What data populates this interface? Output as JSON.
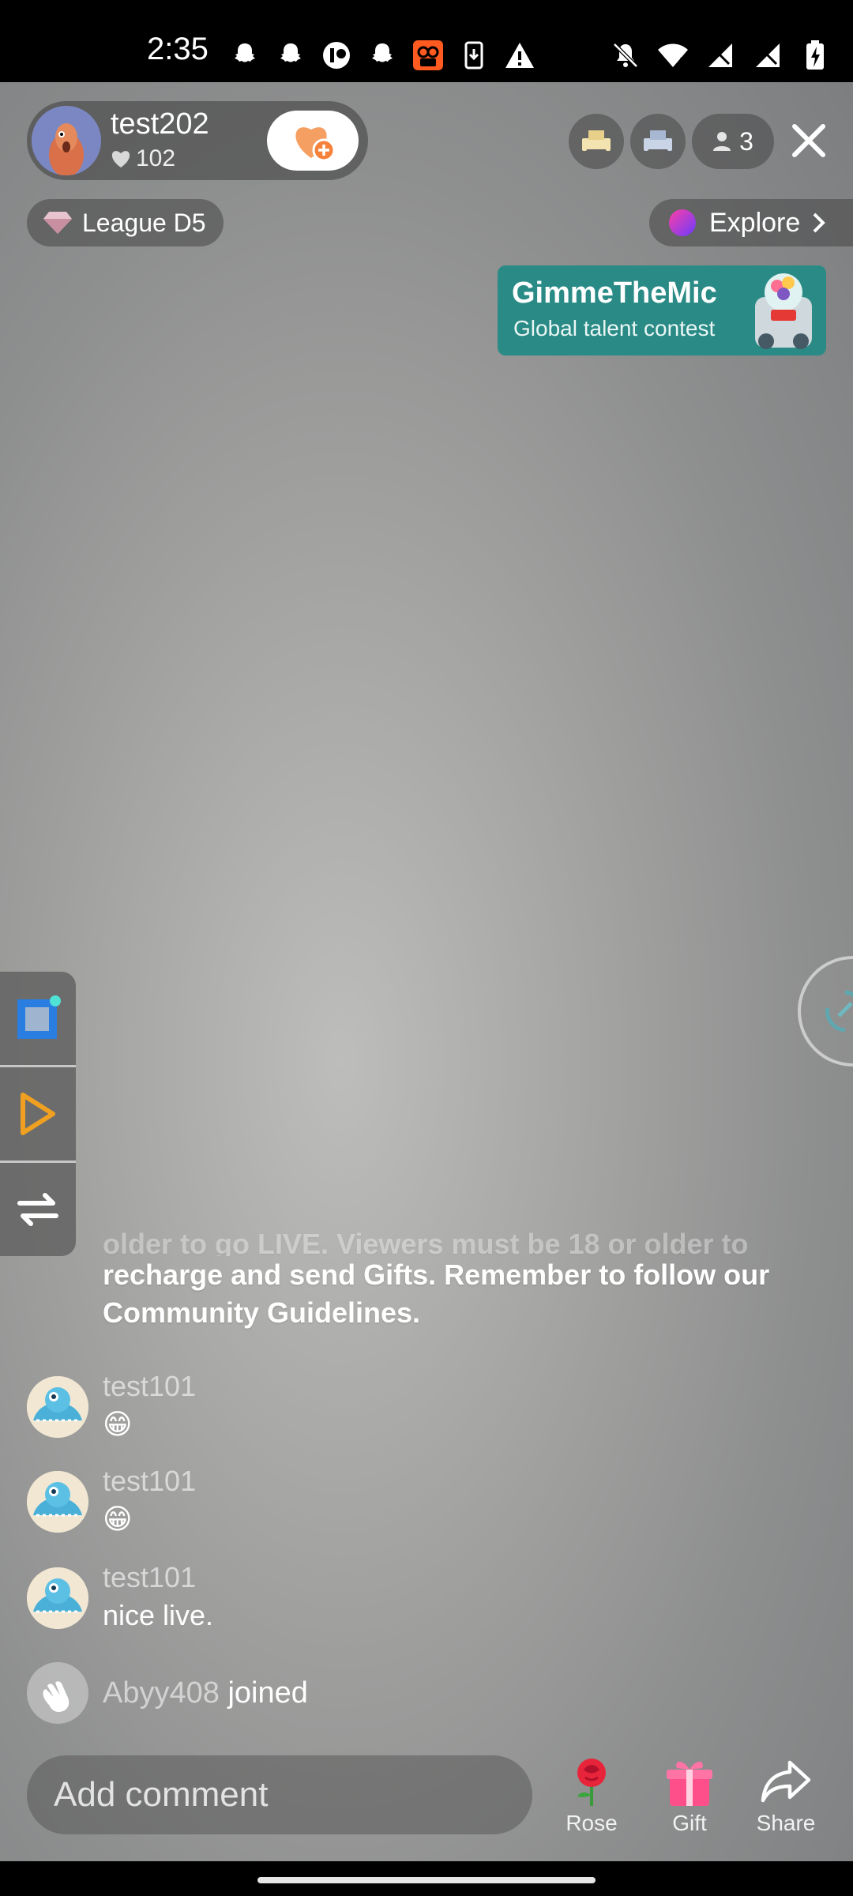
{
  "status_bar": {
    "time": "2:35",
    "left_icons": [
      "snapchat-icon",
      "snapchat-icon",
      "app-icon",
      "snapchat-icon",
      "camera-app-icon",
      "download-icon",
      "warning-icon"
    ],
    "right_icons": [
      "mute-icon",
      "wifi-icon",
      "signal-icon",
      "signal-icon",
      "battery-charging-icon"
    ]
  },
  "host": {
    "name": "test202",
    "likes": "102"
  },
  "viewer_count": "3",
  "league": "League D5",
  "explore": "Explore",
  "banner": {
    "title": "GimmeTheMic",
    "subtitle": "Global talent contest"
  },
  "chat": {
    "notice_faded": "older to go LIVE. Viewers must be 18 or older to",
    "notice": "recharge and send Gifts. Remember to follow our Community Guidelines.",
    "messages": [
      {
        "user": "test101",
        "text": "😁"
      },
      {
        "user": "test101",
        "text": "😁"
      },
      {
        "user": "test101",
        "text": "nice live."
      }
    ],
    "join": {
      "user": "Abyy408",
      "text": "joined"
    }
  },
  "bottom": {
    "comment_placeholder": "Add comment",
    "rose_label": "Rose",
    "gift_label": "Gift",
    "share_label": "Share"
  },
  "colors": {
    "banner_bg": "#2a8b86",
    "follow_heart": "#f5a062",
    "toolbar_play": "#f0a020",
    "toolbar_square": "#2a7de1"
  }
}
